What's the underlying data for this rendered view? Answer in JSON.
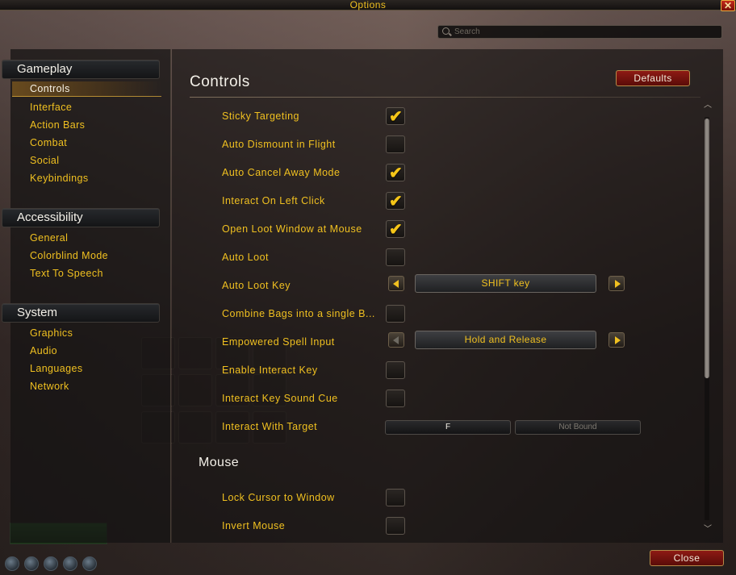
{
  "window": {
    "title": "Options",
    "close_glyph": "✕"
  },
  "search": {
    "placeholder": "Search"
  },
  "sidebar": {
    "categories": [
      {
        "label": "Gameplay",
        "items": [
          "Controls",
          "Interface",
          "Action Bars",
          "Combat",
          "Social",
          "Keybindings"
        ],
        "selected": "Controls"
      },
      {
        "label": "Accessibility",
        "items": [
          "General",
          "Colorblind Mode",
          "Text To Speech"
        ]
      },
      {
        "label": "System",
        "items": [
          "Graphics",
          "Audio",
          "Languages",
          "Network"
        ]
      }
    ]
  },
  "main": {
    "title": "Controls",
    "defaults_label": "Defaults",
    "close_label": "Close",
    "rows": [
      {
        "label": "Sticky Targeting",
        "type": "checkbox",
        "checked": true
      },
      {
        "label": "Auto Dismount in Flight",
        "type": "checkbox",
        "checked": false
      },
      {
        "label": "Auto Cancel Away Mode",
        "type": "checkbox",
        "checked": true
      },
      {
        "label": "Interact On Left Click",
        "type": "checkbox",
        "checked": true
      },
      {
        "label": "Open Loot Window at Mouse",
        "type": "checkbox",
        "checked": true
      },
      {
        "label": "Auto Loot",
        "type": "checkbox",
        "checked": false
      },
      {
        "label": "Auto Loot Key",
        "type": "selector",
        "value": "SHIFT key"
      },
      {
        "label": "Combine Bags into a single B...",
        "type": "checkbox",
        "checked": false
      },
      {
        "label": "Empowered Spell Input",
        "type": "selector",
        "value": "Hold and Release"
      },
      {
        "label": "Enable Interact Key",
        "type": "checkbox",
        "checked": false
      },
      {
        "label": "Interact Key Sound Cue",
        "type": "checkbox",
        "checked": false
      },
      {
        "label": "Interact With Target",
        "type": "binding",
        "primary": "F",
        "secondary": "Not Bound"
      }
    ],
    "mouse_section": {
      "title": "Mouse",
      "rows": [
        {
          "label": "Lock Cursor to Window",
          "type": "checkbox",
          "checked": false
        },
        {
          "label": "Invert Mouse",
          "type": "checkbox",
          "checked": false
        }
      ]
    },
    "check_glyph": "✔"
  },
  "colors": {
    "gold": "#f0c020",
    "red_button": "#8e1a14",
    "heading": "#f3f0e8"
  }
}
